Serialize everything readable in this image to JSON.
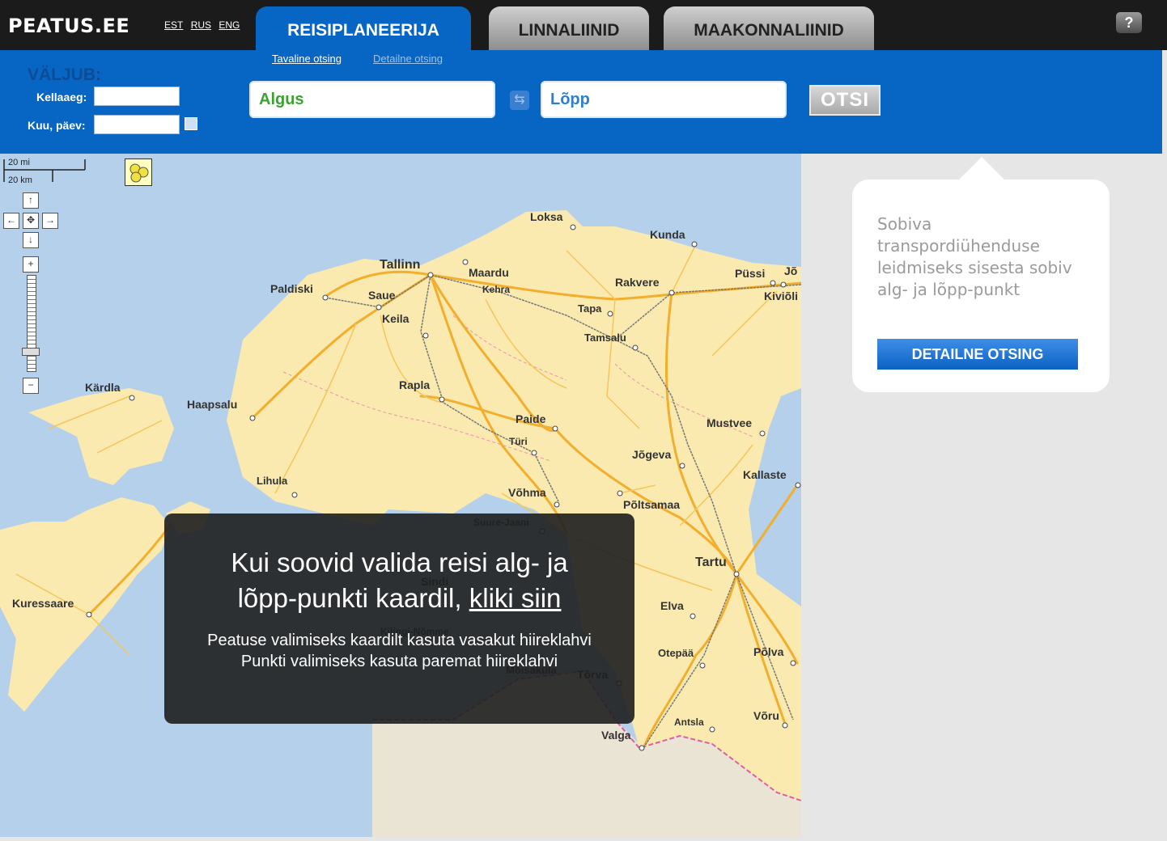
{
  "header": {
    "logo": "PEATUS.EE",
    "languages": [
      "EST",
      "RUS",
      "ENG"
    ],
    "tabs": [
      {
        "label": "REISIPLANEERIJA"
      },
      {
        "label": "LINNALIINID"
      },
      {
        "label": "MAAKONNALIINID"
      }
    ],
    "help": "?"
  },
  "search": {
    "subtabs": [
      "Tavaline otsing",
      "Detailne otsing"
    ],
    "departs_label": "VÄLJUB:",
    "time_label": "Kellaaeg:",
    "date_label": "Kuu, päev:",
    "start_placeholder": "Algus",
    "end_placeholder": "Lõpp",
    "search_button": "OTSI"
  },
  "info": {
    "text": "Sobiva transpordiühenduse leidmiseks sisesta sobiv alg- ja lõpp-punkt",
    "button": "DETAILNE OTSING"
  },
  "overlay": {
    "line1": "Kui soovid valida reisi alg- ja",
    "line2_prefix": "lõpp-punkti kaardil,",
    "line2_link": "kliki siin",
    "hint1": "Peatuse valimiseks kaardilt kasuta vasakut hiireklahvi",
    "hint2": "Punkti valimiseks kasuta paremat hiireklahvi"
  },
  "map": {
    "scale": {
      "mi": "20 mi",
      "km": "20 km"
    },
    "places": [
      "Loksa",
      "Kunda",
      "Tallinn",
      "Maardu",
      "Rakvere",
      "Püssi",
      "Jõ",
      "Kiviõli",
      "Paldiski",
      "Kehra",
      "Saue",
      "Tapa",
      "Keila",
      "Tamsalu",
      "Rapla",
      "Kärdla",
      "Haapsalu",
      "Paide",
      "Mustvee",
      "Türi",
      "Jõgeva",
      "Kallaste",
      "Lihula",
      "Võhma",
      "Põltsamaa",
      "Suure-Jaani",
      "Tartu",
      "Sindi",
      "Kuressaare",
      "Elva",
      "Kilingi-Nõmme",
      "Otepää",
      "Põlva",
      "Mõisaküla",
      "Tõrva",
      "Antsla",
      "Võru",
      "Valga"
    ],
    "colors": {
      "sea": "#b5d0ea",
      "land": "#faeab0",
      "road": "#f2ae2c",
      "rail": "#777777",
      "border": "#e05ca6",
      "latvia": "#e9e4d3"
    }
  }
}
